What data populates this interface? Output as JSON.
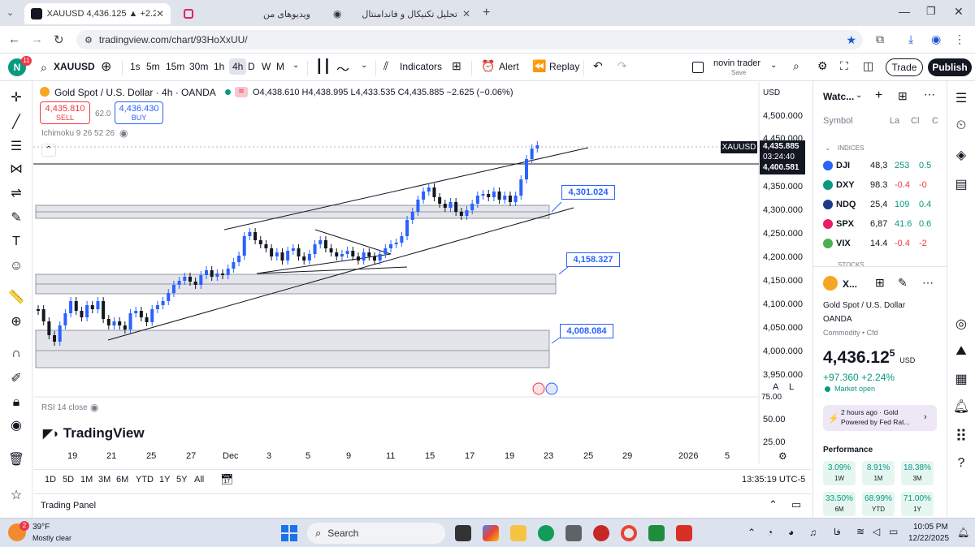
{
  "browser": {
    "tabs": [
      {
        "label": "XAUUSD 4,436.125 ▲ +2.24% ...",
        "active": true
      },
      {
        "label": "ویدیوهای من",
        "active": false
      },
      {
        "label": "تحلیل تکنیکال و فاندامنتال",
        "active": false
      }
    ],
    "url": "tradingview.com/chart/93HoXxUU/"
  },
  "toolbar": {
    "symbol": "XAUUSD",
    "avatar_badge": "11",
    "intervals": [
      "1s",
      "5m",
      "15m",
      "30m",
      "1h",
      "4h",
      "D",
      "W",
      "M"
    ],
    "active_interval": "4h",
    "indicators_label": "Indicators",
    "alert_label": "Alert",
    "replay_label": "Replay",
    "layout_name": "novin trader",
    "layout_sub": "Save",
    "trade_label": "Trade",
    "publish_label": "Publish"
  },
  "chart": {
    "title": "Gold Spot / U.S. Dollar · 4h · OANDA",
    "ohlc": "O4,438.610 H4,438.995 L4,433.535 C4,435.885 −2.625 (−0.06%)",
    "sell_price": "4,435.810",
    "sell_label": "SELL",
    "spread": "62.0",
    "buy_price": "4,436.430",
    "buy_label": "BUY",
    "ichimoku_label": "Ichimoku 9 26 52 26",
    "rsi_label": "RSI 14 close",
    "watermark": "TradingView",
    "currency": "USD",
    "price_tag_symbol": "XAUUSD",
    "price_tag_value": "4,435.885",
    "price_tag_timer": "03:24:40",
    "line_tag_value": "4,400.581",
    "annotations": [
      "4,301.024",
      "4,158.327",
      "4,008.084"
    ],
    "y_axis": [
      "4,500.000",
      "4,450.000",
      "4,350.000",
      "4,300.000",
      "4,250.000",
      "4,200.000",
      "4,150.000",
      "4,100.000",
      "4,050.000",
      "4,000.000",
      "3,950.000"
    ],
    "rsi_axis": [
      "75.00",
      "50.00",
      "25.00"
    ],
    "x_axis": [
      "19",
      "21",
      "25",
      "27",
      "Dec",
      "3",
      "5",
      "9",
      "11",
      "15",
      "17",
      "19",
      "23",
      "25",
      "29",
      "2026",
      "5"
    ],
    "scale_a": "A",
    "scale_l": "L"
  },
  "ranges": [
    "1D",
    "5D",
    "1M",
    "3M",
    "6M",
    "YTD",
    "1Y",
    "5Y",
    "All"
  ],
  "clock": "13:35:19 UTC-5",
  "trading_panel_label": "Trading Panel",
  "watchlist": {
    "header": "Watc...",
    "col_symbol": "Symbol",
    "col_last": "La",
    "col_chg": "Cl",
    "col_chgp": "C",
    "section": "INDICES",
    "section2": "STOCKS",
    "rows": [
      {
        "sym": "DJI",
        "last": "48,3",
        "chg": "253",
        "chgp": "0.5",
        "color": "#089981",
        "icon": "#2962ff"
      },
      {
        "sym": "DXY",
        "last": "98.3",
        "chg": "-0.4",
        "chgp": "-0",
        "color": "#f23645",
        "icon": "#089981"
      },
      {
        "sym": "NDQ",
        "last": "25,4",
        "chg": "109",
        "chgp": "0.4",
        "color": "#089981",
        "icon": "#1e3a8a"
      },
      {
        "sym": "SPX",
        "last": "6,87",
        "chg": "41.6",
        "chgp": "0.6",
        "color": "#089981",
        "icon": "#e91e63"
      },
      {
        "sym": "VIX",
        "last": "14.4",
        "chg": "-0.4",
        "chgp": "-2",
        "color": "#f23645",
        "icon": "#4caf50"
      }
    ]
  },
  "details": {
    "short": "X...",
    "name": "Gold Spot / U.S. Dollar",
    "exchange": "OANDA",
    "category": "Commodity • Cfd",
    "price_main": "4,436.12",
    "price_sup": "5",
    "price_currency": "USD",
    "change": "+97.360 +2.24%",
    "market_status": "Market open",
    "news_time": "2 hours ago · Gold",
    "news_text": "Powered by Fed Rat...",
    "performance_label": "Performance",
    "performance": [
      {
        "value": "3.09%",
        "period": "1W"
      },
      {
        "value": "8.91%",
        "period": "1M"
      },
      {
        "value": "18.38%",
        "period": "3M"
      },
      {
        "value": "33.50%",
        "period": "6M"
      },
      {
        "value": "68.99%",
        "period": "YTD"
      },
      {
        "value": "71.00%",
        "period": "1Y"
      }
    ]
  },
  "taskbar": {
    "weather_temp": "39°F",
    "weather_text": "Mostly clear",
    "weather_badge": "2",
    "search_placeholder": "Search",
    "lang": "فا",
    "time": "10:05 PM",
    "date": "12/22/2025"
  },
  "colors": {
    "up": "#2962ff",
    "down": "#131722",
    "accent": "#2962ff",
    "green": "#089981",
    "red": "#f23645"
  }
}
